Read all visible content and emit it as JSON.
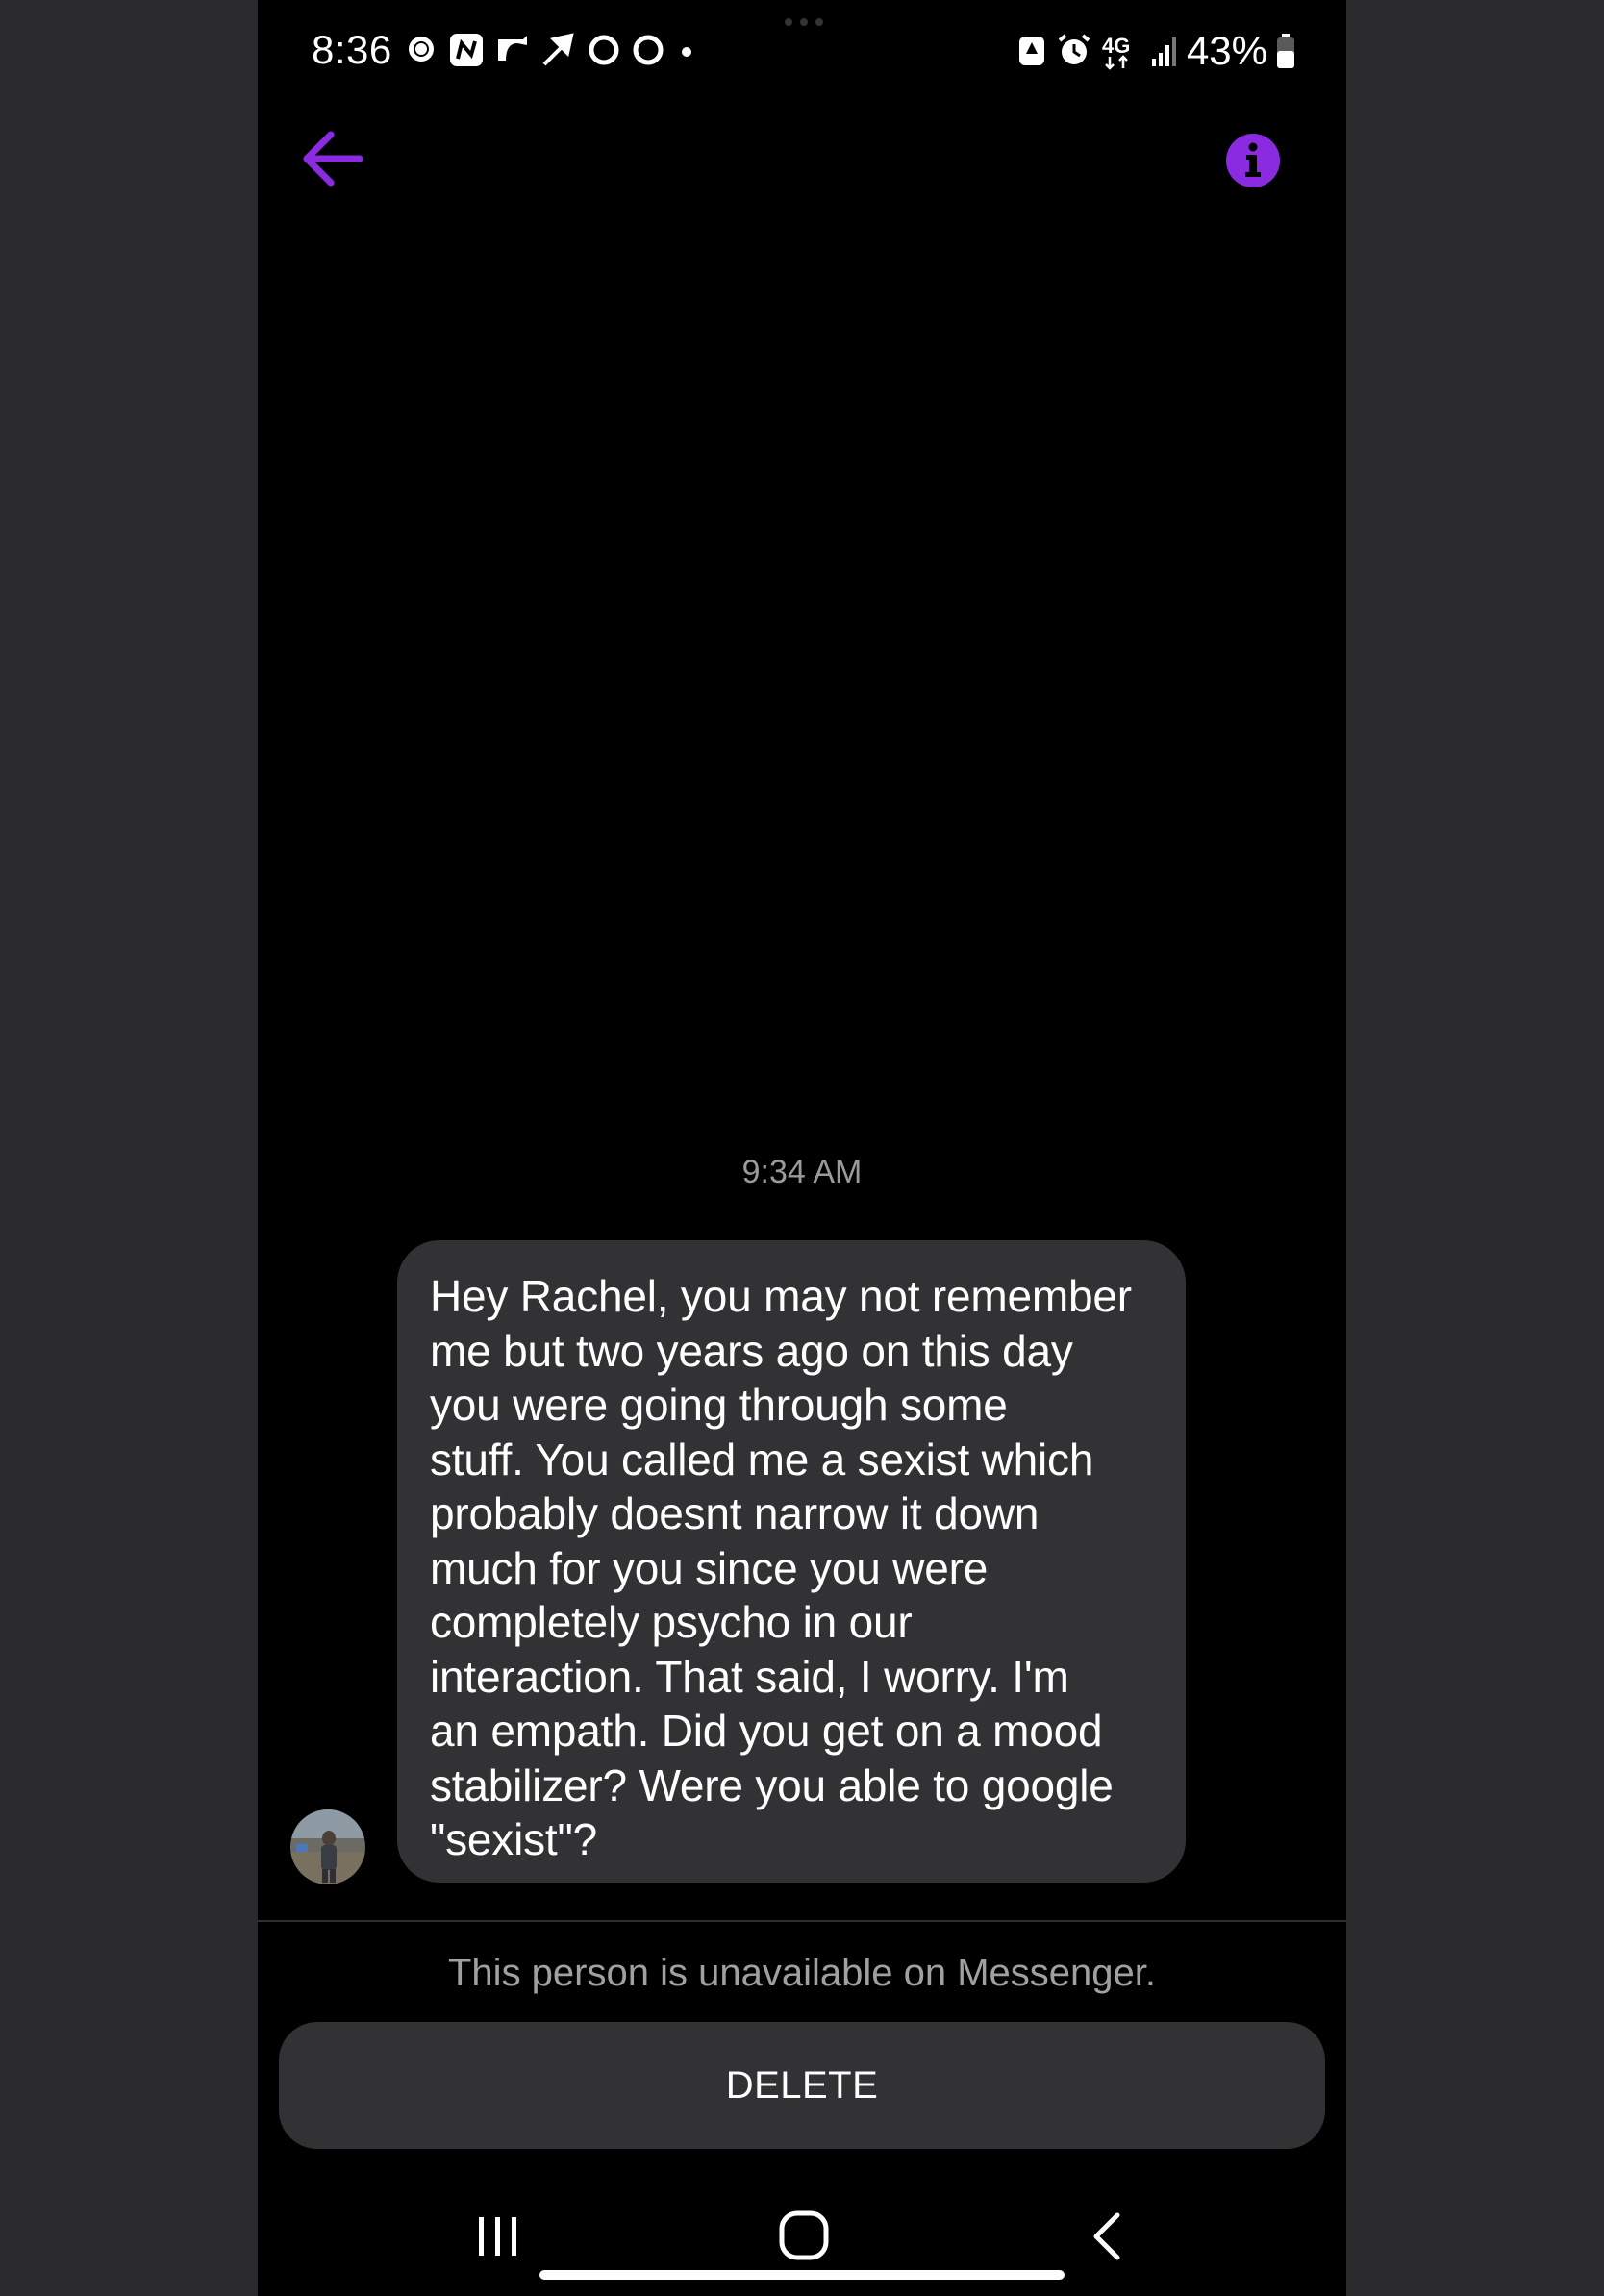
{
  "status_bar": {
    "time": "8:36",
    "battery_percent": "43%",
    "network": "4G"
  },
  "header": {
    "back_icon": "arrow-left-icon",
    "info_icon": "info-icon",
    "accent_color": "#8a2be2"
  },
  "conversation": {
    "timestamp": "9:34 AM",
    "message": {
      "text": "Hey Rachel, you may not remember\nme but two years ago on this day\nyou were going through some\nstuff.  You called me a sexist which\nprobably doesnt narrow it down\nmuch for you since you were\ncompletely psycho in our\ninteraction.  That said, I worry.  I'm\nan empath.  Did you get on a mood\nstabilizer?  Were you able to google\n\"sexist\"?"
    }
  },
  "footer": {
    "unavailable_notice": "This person is unavailable on Messenger.",
    "delete_label": "DELETE"
  },
  "nav_bar": {
    "recent_icon": "recent-apps-icon",
    "home_icon": "home-icon",
    "back_icon": "back-chevron-icon"
  }
}
